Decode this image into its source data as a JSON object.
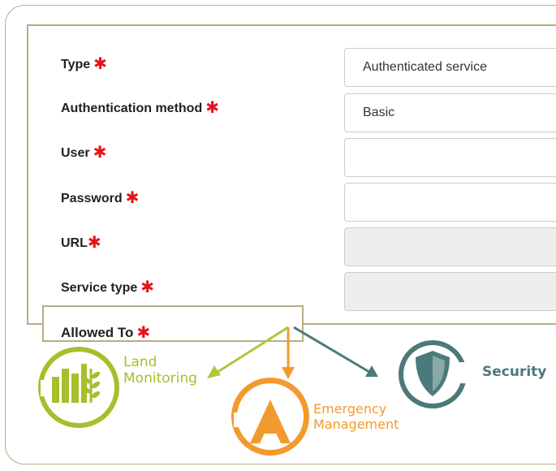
{
  "form": {
    "required_marker": "✱",
    "fields": [
      {
        "label": "Type",
        "value": "Authenticated service"
      },
      {
        "label": "Authentication method",
        "value": "Basic"
      },
      {
        "label": "User",
        "value": ""
      },
      {
        "label": "Password",
        "value": ""
      },
      {
        "label": "URL",
        "value": ""
      },
      {
        "label": "Service type",
        "value": ""
      }
    ],
    "allowed_to_label": "Allowed To"
  },
  "services": [
    {
      "name_line1": "Land",
      "name_line2": "Monitoring",
      "color": "#a6bf2d",
      "icon": "land-monitoring-icon"
    },
    {
      "name_line1": "Emergency",
      "name_line2": "Management",
      "color": "#f39a2e",
      "icon": "emergency-management-icon"
    },
    {
      "name_line1": "Security",
      "color": "#4c7a7a",
      "icon": "security-shield-icon"
    }
  ],
  "colors": {
    "frame": "#b7ad84",
    "required": "#e4141b",
    "arrow_land": "#b4c43a",
    "arrow_emergency": "#f39a2e",
    "arrow_security": "#4c7a7a"
  }
}
